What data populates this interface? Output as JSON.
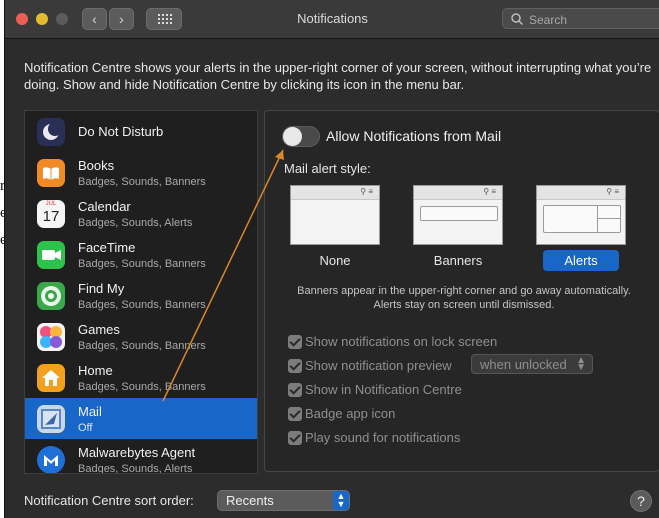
{
  "window": {
    "title": "Notifications"
  },
  "toolbar": {
    "back": "‹",
    "forward": "›",
    "show_all_icon": "grid-icon"
  },
  "search": {
    "placeholder": "Search"
  },
  "intro": "Notification Centre shows your alerts in the upper-right corner of your screen, without interrupting what you’re doing. Show and hide Notification Centre by clicking its icon in the menu bar.",
  "apps": [
    {
      "name": "Do Not Disturb",
      "sub": "",
      "icon": "moon-icon",
      "color": "#2d3a7a"
    },
    {
      "name": "Books",
      "sub": "Badges, Sounds, Banners",
      "icon": "books-icon",
      "color": "#f08a24"
    },
    {
      "name": "Calendar",
      "sub": "Badges, Sounds, Alerts",
      "icon": "calendar-icon",
      "color": "#f5f5f5",
      "badge": "JUL",
      "day": "17"
    },
    {
      "name": "FaceTime",
      "sub": "Badges, Sounds, Banners",
      "icon": "facetime-icon",
      "color": "#2fc24b"
    },
    {
      "name": "Find My",
      "sub": "Badges, Sounds, Banners",
      "icon": "findmy-icon",
      "color": "#3fb950"
    },
    {
      "name": "Games",
      "sub": "Badges, Sounds, Banners",
      "icon": "games-icon",
      "color": "#8a5ad6"
    },
    {
      "name": "Home",
      "sub": "Badges, Sounds, Banners",
      "icon": "home-icon",
      "color": "#f3a11d"
    },
    {
      "name": "Mail",
      "sub": "Off",
      "icon": "mail-icon",
      "color": "#7ea4d0",
      "selected": true
    },
    {
      "name": "Malwarebytes Agent",
      "sub": "Badges, Sounds, Alerts",
      "icon": "malwarebytes-icon",
      "color": "#1f6fd8"
    }
  ],
  "detail": {
    "allow_label": "Allow Notifications from Mail",
    "allow_on": false,
    "style_label": "Mail alert style:",
    "styles": [
      "None",
      "Banners",
      "Alerts"
    ],
    "selected_style": "Alerts",
    "description": "Banners appear in the upper-right corner and go away automatically. Alerts stay on screen until dismissed.",
    "options": [
      {
        "label": "Show notifications on lock screen",
        "checked": true
      },
      {
        "label": "Show notification preview",
        "checked": true,
        "popup": "when unlocked"
      },
      {
        "label": "Show in Notification Centre",
        "checked": true
      },
      {
        "label": "Badge app icon",
        "checked": true
      },
      {
        "label": "Play sound for notifications",
        "checked": true
      }
    ]
  },
  "footer": {
    "sort_label": "Notification Centre sort order:",
    "sort_value": "Recents",
    "help": "?"
  },
  "colors": {
    "accent": "#1866c7",
    "annotation": "#d7882b",
    "window_bg": "#2c2c2c"
  }
}
